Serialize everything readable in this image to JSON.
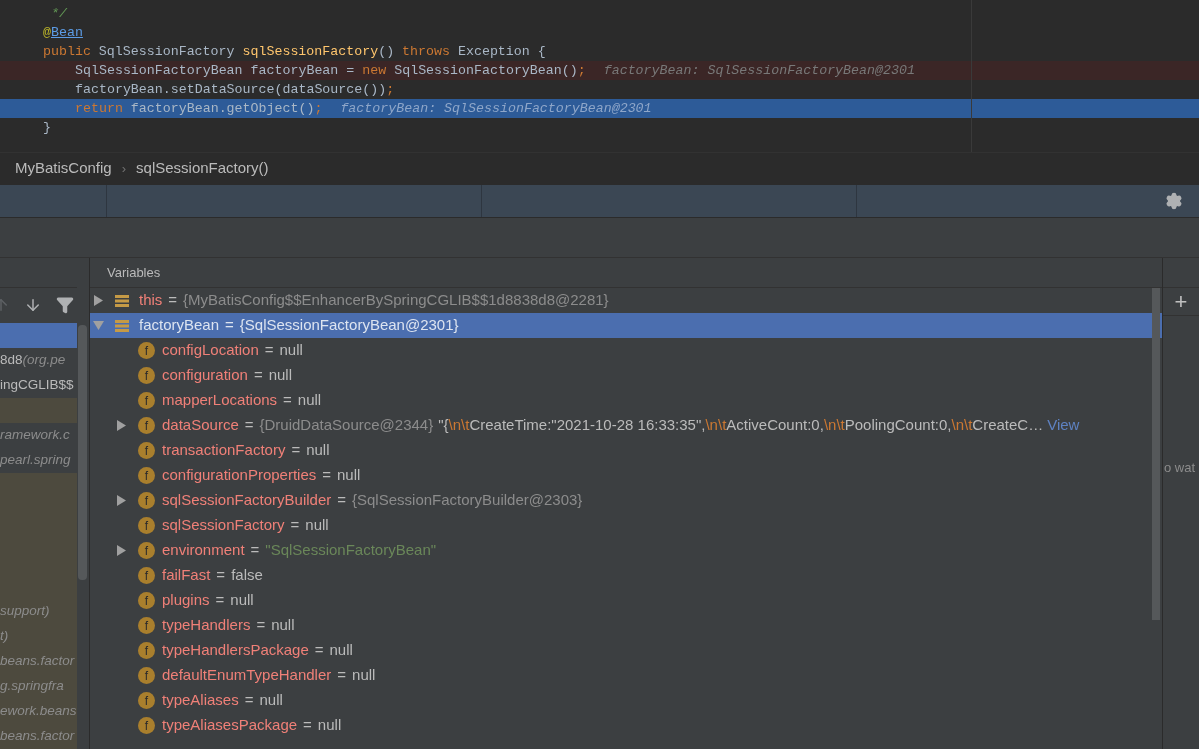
{
  "editor": {
    "lines": [
      {
        "breakpoint": false,
        "current": false,
        "segments": [
          {
            "kind": "comment",
            "text": " */"
          }
        ]
      },
      {
        "breakpoint": false,
        "current": false,
        "segments": [
          {
            "kind": "annotation",
            "text": "@"
          },
          {
            "kind": "link",
            "text": "Bean"
          }
        ]
      },
      {
        "breakpoint": false,
        "current": false,
        "segments": [
          {
            "kind": "keyword",
            "text": "public "
          },
          {
            "kind": "plain",
            "text": "SqlSessionFactory "
          },
          {
            "kind": "method",
            "text": "sqlSessionFactory"
          },
          {
            "kind": "plain",
            "text": "() "
          },
          {
            "kind": "keyword",
            "text": "throws "
          },
          {
            "kind": "plain",
            "text": "Exception {"
          }
        ],
        "children": [
          {
            "breakpoint": true,
            "current": false,
            "segments": [
              {
                "kind": "plain",
                "text": "SqlSessionFactoryBean factoryBean = "
              },
              {
                "kind": "keyword",
                "text": "new "
              },
              {
                "kind": "plain",
                "text": "SqlSessionFactoryBean()"
              },
              {
                "kind": "keyword",
                "text": ";"
              },
              {
                "kind": "hint",
                "text": "factoryBean: SqlSessionFactoryBean@2301"
              }
            ]
          },
          {
            "breakpoint": false,
            "current": false,
            "segments": [
              {
                "kind": "plain",
                "text": "factoryBean.setDataSource(dataSource())"
              },
              {
                "kind": "keyword",
                "text": ";"
              }
            ]
          },
          {
            "breakpoint": false,
            "current": true,
            "segments": [
              {
                "kind": "keyword",
                "text": "return "
              },
              {
                "kind": "plain",
                "text": "factoryBean.getObject()"
              },
              {
                "kind": "keyword",
                "text": ";"
              },
              {
                "kind": "hint",
                "text": "factoryBean: SqlSessionFactoryBean@2301"
              }
            ]
          }
        ]
      },
      {
        "breakpoint": false,
        "current": false,
        "segments": [
          {
            "kind": "plain",
            "text": "}"
          }
        ]
      }
    ]
  },
  "breadcrumbs": [
    {
      "label": "MyBatisConfig",
      "separator": "›"
    },
    {
      "label": "sqlSessionFactory()"
    }
  ],
  "frames_panel": {
    "toolbar": [
      {
        "kind": "up",
        "disabled": true
      },
      {
        "kind": "down",
        "disabled": false
      },
      {
        "kind": "filter",
        "disabled": false
      }
    ],
    "frames": [
      {
        "selected": true,
        "library": false
      },
      {
        "text": "8d8 ",
        "detail": "(org.pe",
        "selected": false,
        "library": false
      },
      {
        "text": "ingCGLIB$$",
        "selected": false,
        "library": false
      },
      {
        "selected": false,
        "library": true
      },
      {
        "detail": "ramework.c",
        "selected": false,
        "library": false
      },
      {
        "detail": "pearl.spring",
        "selected": false,
        "library": false
      },
      {
        "selected": false,
        "library": true
      },
      {
        "selected": false,
        "library": true
      },
      {
        "selected": false,
        "library": true
      },
      {
        "selected": false,
        "library": true
      },
      {
        "selected": false,
        "library": true
      },
      {
        "detail": "support)",
        "selected": false,
        "library": true
      },
      {
        "detail": "t)",
        "selected": false,
        "library": true
      },
      {
        "detail": "beans.factor",
        "selected": false,
        "library": true
      },
      {
        "detail": "g.springfra",
        "selected": false,
        "library": true
      },
      {
        "detail": "ework.beans",
        "selected": false,
        "library": true
      },
      {
        "detail": "beans.factor",
        "selected": false,
        "library": true
      }
    ]
  },
  "variables": {
    "title": "Variables",
    "rows": [
      {
        "name": "this",
        "icon": {
          "kind": "object"
        },
        "expandable": true,
        "expanded": false,
        "selected": false,
        "operator": "=",
        "value": [
          {
            "kind": "ref",
            "text": "{MyBatisConfig$$EnhancerBySpringCGLIB$$1d8838d8@2281}"
          }
        ]
      },
      {
        "name": "factoryBean",
        "icon": {
          "kind": "object"
        },
        "expandable": true,
        "expanded": true,
        "selected": true,
        "operator": "=",
        "value": [
          {
            "kind": "ref",
            "text": "{SqlSessionFactoryBean@2301}"
          }
        ],
        "children": [
          {
            "name": "configLocation",
            "icon": {
              "kind": "field",
              "glyph": "f"
            },
            "expandable": false,
            "selected": false,
            "operator": "=",
            "value": [
              {
                "kind": "plain",
                "text": "null"
              }
            ]
          },
          {
            "name": "configuration",
            "icon": {
              "kind": "field",
              "glyph": "f"
            },
            "expandable": false,
            "selected": false,
            "operator": "=",
            "value": [
              {
                "kind": "plain",
                "text": "null"
              }
            ]
          },
          {
            "name": "mapperLocations",
            "icon": {
              "kind": "field",
              "glyph": "f"
            },
            "expandable": false,
            "selected": false,
            "operator": "=",
            "value": [
              {
                "kind": "plain",
                "text": "null"
              }
            ]
          },
          {
            "name": "dataSource",
            "icon": {
              "kind": "field",
              "glyph": "f"
            },
            "expandable": true,
            "expanded": false,
            "selected": false,
            "operator": "=",
            "value": [
              {
                "kind": "ref",
                "text": "{DruidDataSource@2344}"
              },
              {
                "kind": "plain",
                "text": "\"{"
              },
              {
                "kind": "escape",
                "text": "\\n\\t"
              },
              {
                "kind": "plain",
                "text": "CreateTime:\"2021-10-28 16:33:35\","
              },
              {
                "kind": "escape",
                "text": "\\n\\t"
              },
              {
                "kind": "plain",
                "text": "ActiveCount:0,"
              },
              {
                "kind": "escape",
                "text": "\\n\\t"
              },
              {
                "kind": "plain",
                "text": "PoolingCount:0,"
              },
              {
                "kind": "escape",
                "text": "\\n\\t"
              },
              {
                "kind": "plain",
                "text": "CreateC…"
              },
              {
                "kind": "link",
                "text": "View"
              }
            ]
          },
          {
            "name": "transactionFactory",
            "icon": {
              "kind": "field",
              "glyph": "f"
            },
            "expandable": false,
            "selected": false,
            "operator": "=",
            "value": [
              {
                "kind": "plain",
                "text": "null"
              }
            ]
          },
          {
            "name": "configurationProperties",
            "icon": {
              "kind": "field",
              "glyph": "f"
            },
            "expandable": false,
            "selected": false,
            "operator": "=",
            "value": [
              {
                "kind": "plain",
                "text": "null"
              }
            ]
          },
          {
            "name": "sqlSessionFactoryBuilder",
            "icon": {
              "kind": "field",
              "glyph": "f"
            },
            "expandable": true,
            "expanded": false,
            "selected": false,
            "operator": "=",
            "value": [
              {
                "kind": "ref",
                "text": "{SqlSessionFactoryBuilder@2303}"
              }
            ]
          },
          {
            "name": "sqlSessionFactory",
            "icon": {
              "kind": "field",
              "glyph": "f"
            },
            "expandable": false,
            "selected": false,
            "operator": "=",
            "value": [
              {
                "kind": "plain",
                "text": "null"
              }
            ]
          },
          {
            "name": "environment",
            "icon": {
              "kind": "field",
              "glyph": "f"
            },
            "expandable": true,
            "expanded": false,
            "selected": false,
            "operator": "=",
            "value": [
              {
                "kind": "string",
                "text": "\"SqlSessionFactoryBean\""
              }
            ]
          },
          {
            "name": "failFast",
            "icon": {
              "kind": "field",
              "glyph": "f"
            },
            "expandable": false,
            "selected": false,
            "operator": "=",
            "value": [
              {
                "kind": "plain",
                "text": "false"
              }
            ]
          },
          {
            "name": "plugins",
            "icon": {
              "kind": "field",
              "glyph": "f"
            },
            "expandable": false,
            "selected": false,
            "operator": "=",
            "value": [
              {
                "kind": "plain",
                "text": "null"
              }
            ]
          },
          {
            "name": "typeHandlers",
            "icon": {
              "kind": "field",
              "glyph": "f"
            },
            "expandable": false,
            "selected": false,
            "operator": "=",
            "value": [
              {
                "kind": "plain",
                "text": "null"
              }
            ]
          },
          {
            "name": "typeHandlersPackage",
            "icon": {
              "kind": "field",
              "glyph": "f"
            },
            "expandable": false,
            "selected": false,
            "operator": "=",
            "value": [
              {
                "kind": "plain",
                "text": "null"
              }
            ]
          },
          {
            "name": "defaultEnumTypeHandler",
            "icon": {
              "kind": "field",
              "glyph": "f"
            },
            "expandable": false,
            "selected": false,
            "operator": "=",
            "value": [
              {
                "kind": "plain",
                "text": "null"
              }
            ]
          },
          {
            "name": "typeAliases",
            "icon": {
              "kind": "field",
              "glyph": "f"
            },
            "expandable": false,
            "selected": false,
            "operator": "=",
            "value": [
              {
                "kind": "plain",
                "text": "null"
              }
            ]
          },
          {
            "name": "typeAliasesPackage",
            "icon": {
              "kind": "field",
              "glyph": "f"
            },
            "expandable": false,
            "selected": false,
            "operator": "=",
            "value": [
              {
                "kind": "plain",
                "text": "null"
              }
            ]
          }
        ]
      }
    ]
  },
  "watches": {
    "add_button": "+",
    "hint": "o wat"
  }
}
